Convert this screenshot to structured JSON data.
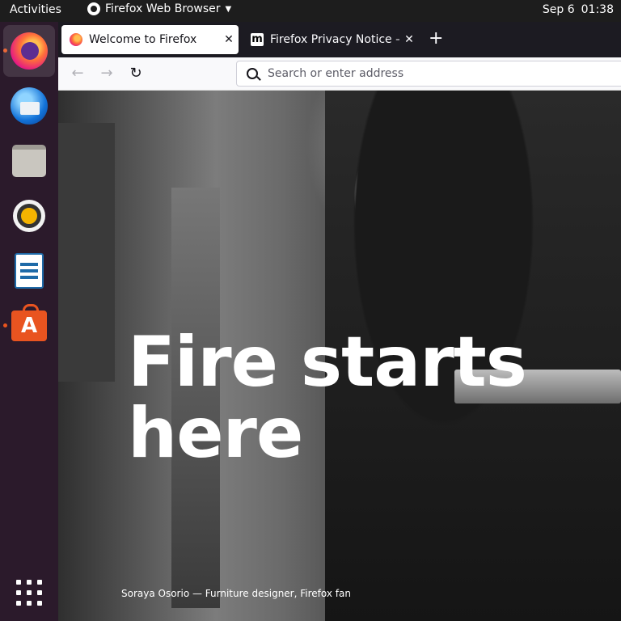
{
  "topbar": {
    "activities": "Activities",
    "app_name": "Firefox Web Browser",
    "date": "Sep 6",
    "time": "01:38"
  },
  "dock": {
    "items": [
      {
        "name": "Firefox",
        "icon": "firefox-icon",
        "running": true
      },
      {
        "name": "Thunderbird",
        "icon": "thunderbird-icon",
        "running": false
      },
      {
        "name": "Files",
        "icon": "files-icon",
        "running": false
      },
      {
        "name": "Rhythmbox",
        "icon": "rhythmbox-icon",
        "running": false
      },
      {
        "name": "LibreOffice Writer",
        "icon": "writer-icon",
        "running": false
      },
      {
        "name": "Ubuntu Software",
        "icon": "software-store-icon",
        "running": true
      }
    ],
    "show_apps_icon": "app-grid-icon",
    "running_dot_color": "#e9541d"
  },
  "browser": {
    "tabs": [
      {
        "title": "Welcome to Firefox",
        "active": true,
        "icon": "firefox-icon"
      },
      {
        "title": "Firefox Privacy Notice —",
        "active": false,
        "icon": "mozilla-m-icon"
      }
    ],
    "new_tab": "+",
    "nav": {
      "back": "←",
      "forward": "→",
      "reload": "↻"
    },
    "urlbar": {
      "placeholder": "Search or enter address",
      "value": ""
    }
  },
  "page": {
    "headline_line1": "Fire starts",
    "headline_line2": "here",
    "caption": "Soraya Osorio — Furniture designer, Firefox fan"
  },
  "colors": {
    "topbar_bg": "#1d1d1d",
    "dock_bg": "#2b1a2b",
    "tabstrip_bg": "#1c1b22",
    "navbar_bg": "#f9f9fb"
  }
}
